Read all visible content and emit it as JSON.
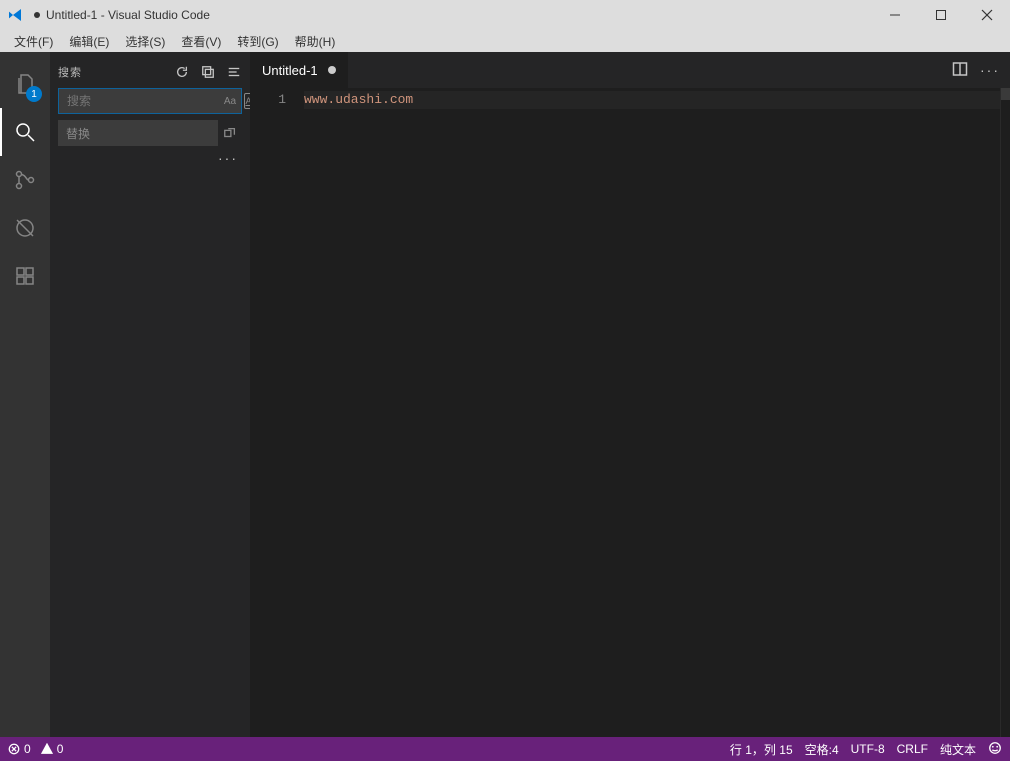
{
  "title": "Untitled-1 - Visual Studio Code",
  "menu": {
    "file": "文件(F)",
    "edit": "编辑(E)",
    "select": "选择(S)",
    "view": "查看(V)",
    "goto": "转到(G)",
    "help": "帮助(H)"
  },
  "activity": {
    "explorer_badge": "1"
  },
  "sidebar": {
    "header_title": "搜索",
    "search_placeholder": "搜索",
    "match_case": "Aa",
    "abl": "Abl",
    "replace_placeholder": "替换",
    "more": "···"
  },
  "tabs": {
    "t0": {
      "label": "Untitled-1"
    }
  },
  "editor_actions": {
    "more": "···"
  },
  "editor": {
    "line1_no": "1",
    "line1_text": "www.udashi.com"
  },
  "status": {
    "errors": "0",
    "warnings": "0",
    "cursor": "行 1，列 15",
    "spaces": "空格:4",
    "encoding": "UTF-8",
    "eol": "CRLF",
    "mode": "纯文本"
  }
}
